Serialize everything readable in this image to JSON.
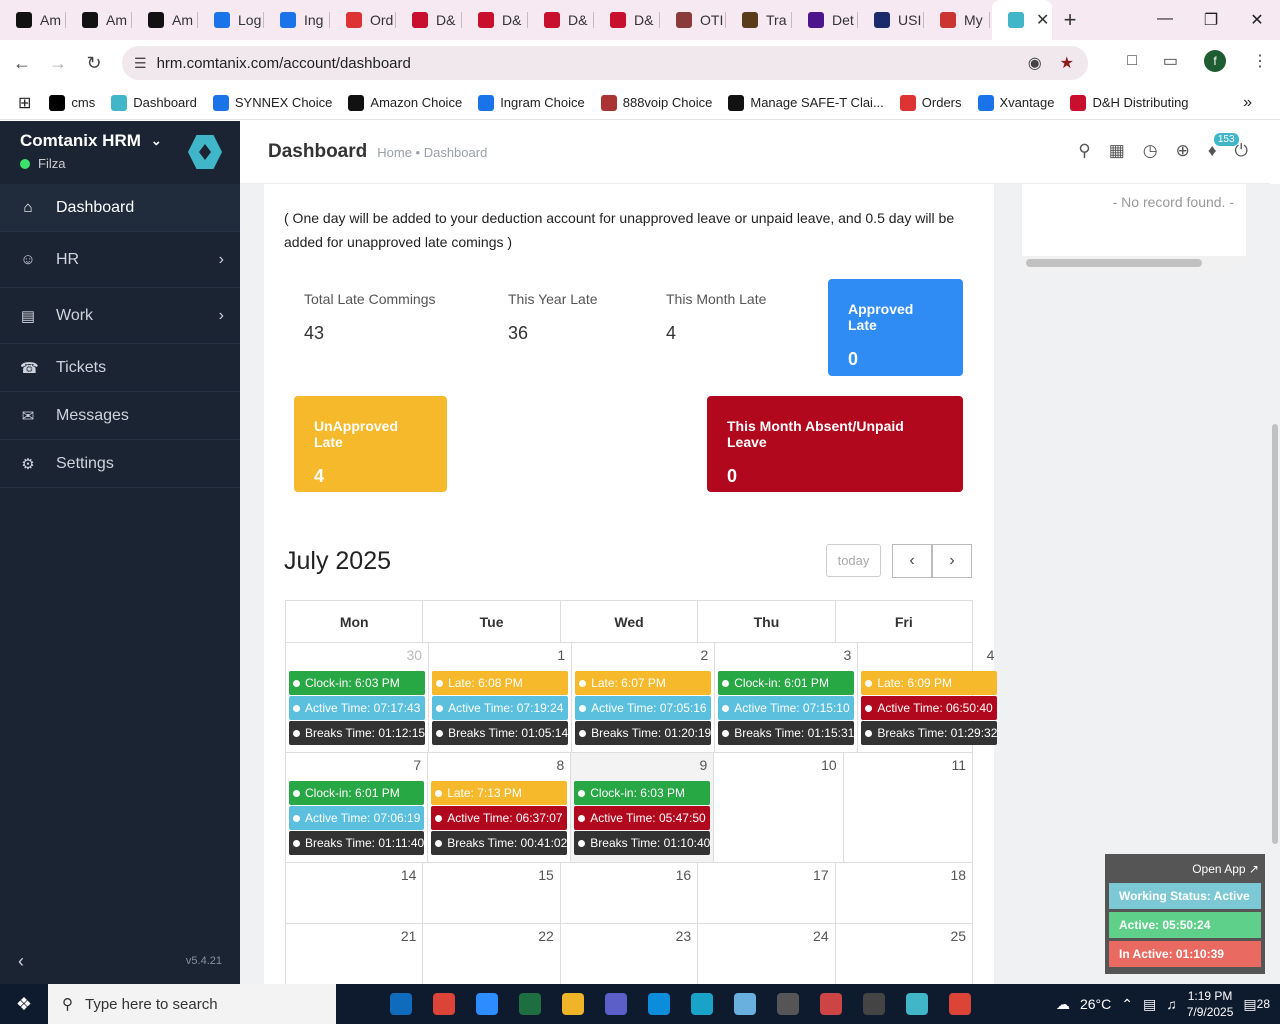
{
  "browser": {
    "tabs": [
      {
        "title": "Am",
        "icon": "amazon-icon",
        "color": "#111"
      },
      {
        "title": "Am",
        "icon": "amazon-icon",
        "color": "#111"
      },
      {
        "title": "Am",
        "icon": "amazon-icon",
        "color": "#111"
      },
      {
        "title": "Log",
        "icon": "ec-icon",
        "color": "#1a73e8"
      },
      {
        "title": "Ing",
        "icon": "ingram-icon",
        "color": "#1a73e8"
      },
      {
        "title": "Ord",
        "icon": "orders-icon",
        "color": "#d33"
      },
      {
        "title": "D&",
        "icon": "dh-icon",
        "color": "#c8102e"
      },
      {
        "title": "D&",
        "icon": "dh-icon",
        "color": "#c8102e"
      },
      {
        "title": "D&",
        "icon": "dh-icon",
        "color": "#c8102e"
      },
      {
        "title": "D&",
        "icon": "dh-icon",
        "color": "#c8102e"
      },
      {
        "title": "OTI",
        "icon": "oti-icon",
        "color": "#8b3a3a"
      },
      {
        "title": "Tra",
        "icon": "ups-icon",
        "color": "#5a3b1a"
      },
      {
        "title": "Det",
        "icon": "fedex-icon",
        "color": "#4d148c"
      },
      {
        "title": "USI",
        "icon": "usps-icon",
        "color": "#1b2a6b"
      },
      {
        "title": "My",
        "icon": "my-icon",
        "color": "#c33"
      }
    ],
    "url": "hrm.comtanix.com/account/dashboard",
    "profile_initial": "f",
    "bookmarks": [
      {
        "label": "cms",
        "color": "#000"
      },
      {
        "label": "Dashboard",
        "color": "#41b6c8"
      },
      {
        "label": "SYNNEX Choice",
        "color": "#1a73e8"
      },
      {
        "label": "Amazon Choice",
        "color": "#111"
      },
      {
        "label": "Ingram Choice",
        "color": "#1a73e8"
      },
      {
        "label": "888voip Choice",
        "color": "#a33"
      },
      {
        "label": "Manage SAFE-T Clai...",
        "color": "#111"
      },
      {
        "label": "Orders",
        "color": "#d33"
      },
      {
        "label": "Xvantage",
        "color": "#1a73e8"
      },
      {
        "label": "D&H Distributing",
        "color": "#c8102e"
      }
    ]
  },
  "sidebar": {
    "brand": "Comtanix HRM",
    "user": "Filza",
    "items": [
      {
        "label": "Dashboard",
        "icon": "home-icon"
      },
      {
        "label": "HR",
        "icon": "users-icon"
      },
      {
        "label": "Work",
        "icon": "briefcase-icon"
      },
      {
        "label": "Tickets",
        "icon": "headset-icon"
      },
      {
        "label": "Messages",
        "icon": "message-icon"
      },
      {
        "label": "Settings",
        "icon": "gear-icon"
      }
    ],
    "version": "v5.4.21"
  },
  "header": {
    "title": "Dashboard",
    "breadcrumb": "Home • Dashboard",
    "notification_count": "153"
  },
  "note": "( One day will be added to your deduction account for unapproved leave or unpaid leave, and 0.5 day will be added for unapproved late comings )",
  "stats": {
    "total_late_label": "Total Late Commings",
    "total_late": "43",
    "year_late_label": "This Year Late",
    "year_late": "36",
    "month_late_label": "This Month Late",
    "month_late": "4",
    "approved_late_label": "Approved Late",
    "approved_late": "0",
    "unapproved_late_label": "UnApproved Late",
    "unapproved_late": "4",
    "absent_label": "This Month Absent/Unpaid Leave",
    "absent": "0"
  },
  "calendar": {
    "title": "July 2025",
    "today_label": "today",
    "days": [
      "Mon",
      "Tue",
      "Wed",
      "Thu",
      "Fri"
    ],
    "weeks": [
      [
        {
          "d": "30",
          "other": true,
          "events": [
            [
              "Clock-in: 6:03 PM",
              "green"
            ],
            [
              "Active Time: 07:17:43",
              "teal"
            ],
            [
              "Breaks Time: 01:12:15",
              "dark"
            ]
          ]
        },
        {
          "d": "1",
          "events": [
            [
              "Late: 6:08 PM",
              "yellow"
            ],
            [
              "Active Time: 07:19:24",
              "teal"
            ],
            [
              "Breaks Time: 01:05:14",
              "dark"
            ]
          ]
        },
        {
          "d": "2",
          "events": [
            [
              "Late: 6:07 PM",
              "yellow"
            ],
            [
              "Active Time: 07:05:16",
              "teal"
            ],
            [
              "Breaks Time: 01:20:19",
              "dark"
            ]
          ]
        },
        {
          "d": "3",
          "events": [
            [
              "Clock-in: 6:01 PM",
              "green"
            ],
            [
              "Active Time: 07:15:10",
              "teal"
            ],
            [
              "Breaks Time: 01:15:31",
              "dark"
            ]
          ]
        },
        {
          "d": "4",
          "events": [
            [
              "Late: 6:09 PM",
              "yellow"
            ],
            [
              "Active Time: 06:50:40",
              "red"
            ],
            [
              "Breaks Time: 01:29:32",
              "dark"
            ]
          ]
        }
      ],
      [
        {
          "d": "7",
          "events": [
            [
              "Clock-in: 6:01 PM",
              "green"
            ],
            [
              "Active Time: 07:06:19",
              "teal"
            ],
            [
              "Breaks Time: 01:11:40",
              "dark"
            ]
          ]
        },
        {
          "d": "8",
          "events": [
            [
              "Late: 7:13 PM",
              "yellow"
            ],
            [
              "Active Time: 06:37:07",
              "red"
            ],
            [
              "Breaks Time: 00:41:02",
              "dark"
            ]
          ]
        },
        {
          "d": "9",
          "today": true,
          "events": [
            [
              "Clock-in: 6:03 PM",
              "green"
            ],
            [
              "Active Time: 05:47:50",
              "red"
            ],
            [
              "Breaks Time: 01:10:40",
              "dark"
            ]
          ]
        },
        {
          "d": "10",
          "events": []
        },
        {
          "d": "11",
          "events": []
        }
      ],
      [
        {
          "d": "14",
          "events": []
        },
        {
          "d": "15",
          "events": []
        },
        {
          "d": "16",
          "events": []
        },
        {
          "d": "17",
          "events": []
        },
        {
          "d": "18",
          "events": []
        }
      ],
      [
        {
          "d": "21",
          "events": []
        },
        {
          "d": "22",
          "events": []
        },
        {
          "d": "23",
          "events": []
        },
        {
          "d": "24",
          "events": []
        },
        {
          "d": "25",
          "events": []
        }
      ]
    ]
  },
  "right_panel": {
    "no_record": "- No record found. -"
  },
  "widget": {
    "open_app": "Open App ↗",
    "working_status": "Working Status: Active",
    "active": "Active: 05:50:24",
    "inactive": "In Active: 01:10:39"
  },
  "taskbar": {
    "search_placeholder": "Type here to search",
    "weather": "26°C",
    "time": "1:19 PM",
    "date": "7/9/2025",
    "notifications": "28",
    "apps": [
      {
        "icon": "task-view-icon",
        "color": "#0e1a2e"
      },
      {
        "icon": "outlook-icon",
        "color": "#0f6cbd"
      },
      {
        "icon": "chrome-icon",
        "color": "#db4437"
      },
      {
        "icon": "zoom-icon",
        "color": "#2d8cff"
      },
      {
        "icon": "excel-icon",
        "color": "#1d6f42"
      },
      {
        "icon": "file-explorer-icon",
        "color": "#f0b429"
      },
      {
        "icon": "teams-icon",
        "color": "#5b5fc7"
      },
      {
        "icon": "edge-icon",
        "color": "#0c8ddb"
      },
      {
        "icon": "app-s-icon",
        "color": "#1aa3c8"
      },
      {
        "icon": "notes-icon",
        "color": "#6ab0de"
      },
      {
        "icon": "settings-icon",
        "color": "#555"
      },
      {
        "icon": "app-ring-icon",
        "color": "#c44"
      },
      {
        "icon": "calculator-icon",
        "color": "#444"
      },
      {
        "icon": "hrm-app-icon",
        "color": "#41b6c8"
      },
      {
        "icon": "chrome-profile-icon",
        "color": "#db4437"
      }
    ]
  },
  "colors": {
    "green": "#28a745",
    "teal": "#5bc0de",
    "yellow": "#f6b92b",
    "red": "#b2081d",
    "dark": "#333333",
    "blue": "#2f8cf4",
    "amber": "#f6b92b",
    "crimson": "#b2081d",
    "widget_teal": "#7cc8d4",
    "widget_green": "#5fd08a",
    "widget_red": "#e86a60"
  }
}
